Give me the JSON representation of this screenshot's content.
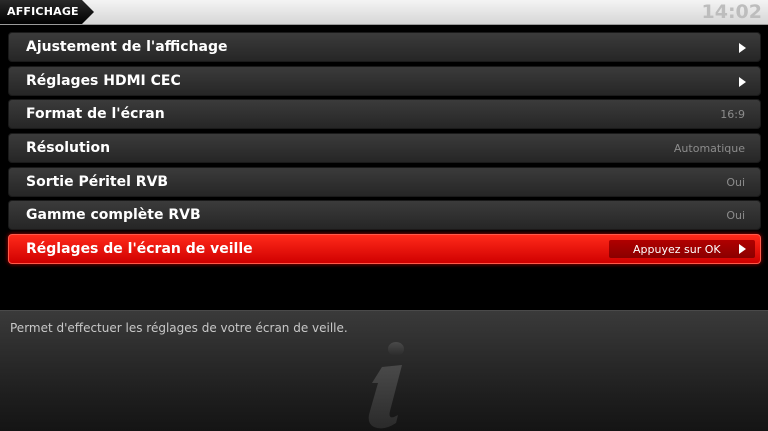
{
  "header": {
    "title": "AFFICHAGE",
    "clock": "14:02"
  },
  "list": {
    "items": [
      {
        "label": "Ajustement de l'affichage",
        "value": "",
        "has_arrow": true
      },
      {
        "label": "Réglages HDMI CEC",
        "value": "",
        "has_arrow": true
      },
      {
        "label": "Format de l'écran",
        "value": "16:9",
        "has_arrow": false
      },
      {
        "label": "Résolution",
        "value": "Automatique",
        "has_arrow": false
      },
      {
        "label": "Sortie Péritel RVB",
        "value": "Oui",
        "has_arrow": false
      },
      {
        "label": "Gamme complète RVB",
        "value": "Oui",
        "has_arrow": false
      },
      {
        "label": "Réglages de l'écran de veille",
        "value": "Appuyez sur OK",
        "has_arrow": true,
        "selected": true
      }
    ]
  },
  "info": {
    "description": "Permet d'effectuer les réglages de votre écran de veille.",
    "icon": "info-icon"
  },
  "colors": {
    "accent": "#e00000",
    "header_bg": "#e6e6e6",
    "row_bg": "#2f2f2f",
    "value_text": "#8c8c8c"
  }
}
